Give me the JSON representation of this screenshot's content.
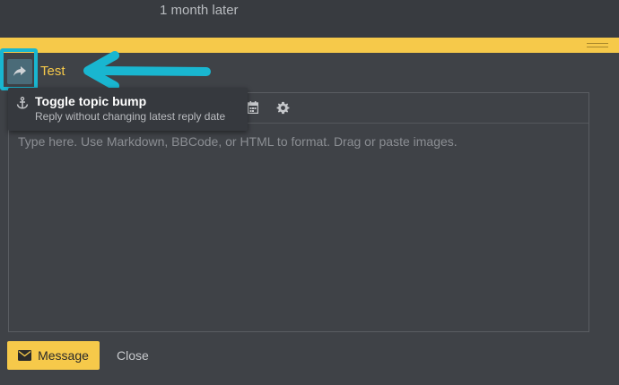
{
  "timeline": {
    "gap_label": "1 month later"
  },
  "composer": {
    "topic_title": "Test",
    "editor_placeholder": "Type here. Use Markdown, BBCode, or HTML to format. Drag or paste images.",
    "tooltip": {
      "title": "Toggle topic bump",
      "subtitle": "Reply without changing latest reply date"
    },
    "submit_label": "Message",
    "close_label": "Close"
  },
  "colors": {
    "accent": "#f6c94a",
    "annotation": "#19b6d0",
    "background": "#3f4247"
  }
}
